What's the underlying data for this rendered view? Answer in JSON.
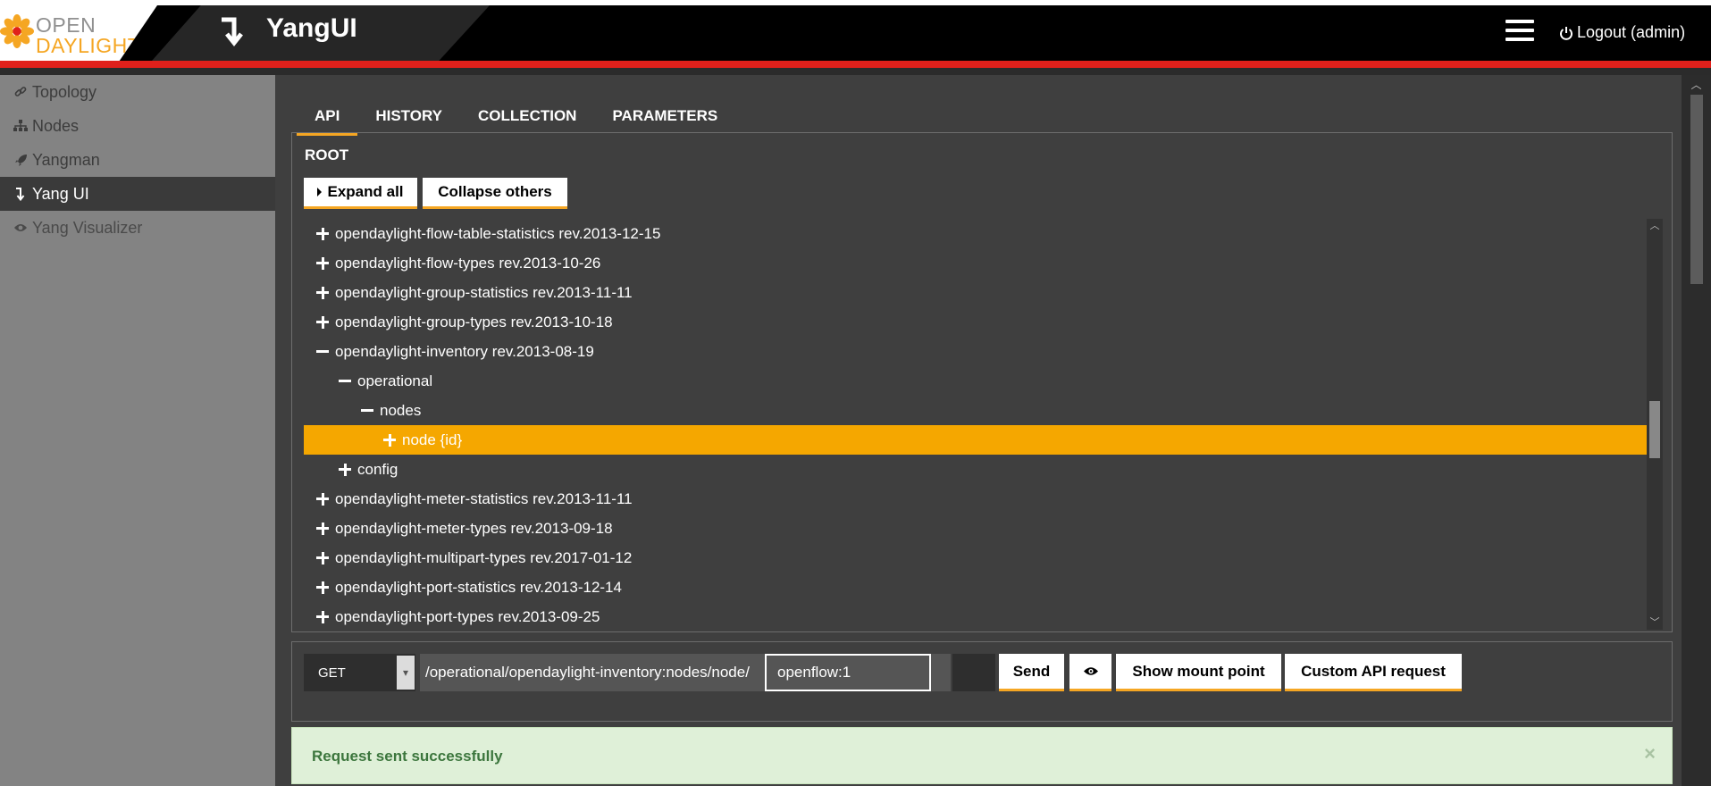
{
  "header": {
    "logo_line1": "OPEN",
    "logo_line2": "DAYLIGHT",
    "app_title": "YangUI",
    "logout_label": "Logout (admin)"
  },
  "sidebar": {
    "items": [
      {
        "label": "Topology",
        "icon": "link-icon"
      },
      {
        "label": "Nodes",
        "icon": "sitemap-icon"
      },
      {
        "label": "Yangman",
        "icon": "rocket-icon"
      },
      {
        "label": "Yang UI",
        "icon": "turn-down-icon",
        "active": true
      },
      {
        "label": "Yang Visualizer",
        "icon": "eye-icon"
      }
    ]
  },
  "tabs": [
    "API",
    "HISTORY",
    "COLLECTION",
    "PARAMETERS"
  ],
  "api": {
    "root_label": "ROOT",
    "expand_all": "Expand all",
    "collapse_others": "Collapse others",
    "tree": [
      {
        "label": "opendaylight-flow-table-statistics rev.2013-12-15",
        "depth": 0,
        "expanded": false
      },
      {
        "label": "opendaylight-flow-types rev.2013-10-26",
        "depth": 0,
        "expanded": false
      },
      {
        "label": "opendaylight-group-statistics rev.2013-11-11",
        "depth": 0,
        "expanded": false
      },
      {
        "label": "opendaylight-group-types rev.2013-10-18",
        "depth": 0,
        "expanded": false
      },
      {
        "label": "opendaylight-inventory rev.2013-08-19",
        "depth": 0,
        "expanded": true
      },
      {
        "label": "operational",
        "depth": 1,
        "expanded": true
      },
      {
        "label": "nodes",
        "depth": 2,
        "expanded": true
      },
      {
        "label": "node {id}",
        "depth": 3,
        "expanded": false,
        "selected": true
      },
      {
        "label": "config",
        "depth": 1,
        "expanded": false
      },
      {
        "label": "opendaylight-meter-statistics rev.2013-11-11",
        "depth": 0,
        "expanded": false
      },
      {
        "label": "opendaylight-meter-types rev.2013-09-18",
        "depth": 0,
        "expanded": false
      },
      {
        "label": "opendaylight-multipart-types rev.2017-01-12",
        "depth": 0,
        "expanded": false
      },
      {
        "label": "opendaylight-port-statistics rev.2013-12-14",
        "depth": 0,
        "expanded": false
      },
      {
        "label": "opendaylight-port-types rev.2013-09-25",
        "depth": 0,
        "expanded": false
      }
    ]
  },
  "request": {
    "method": "GET",
    "path": "/operational/opendaylight-inventory:nodes/node/",
    "id_value": "openflow:1",
    "send_label": "Send",
    "show_mount_label": "Show mount point",
    "custom_api_label": "Custom API request"
  },
  "alert": {
    "message": "Request sent successfully",
    "close": "×"
  },
  "colors": {
    "accent": "#f5a623",
    "selected_row": "#f5a700",
    "header_red": "#e0201b",
    "success_bg": "#dff0d8"
  }
}
